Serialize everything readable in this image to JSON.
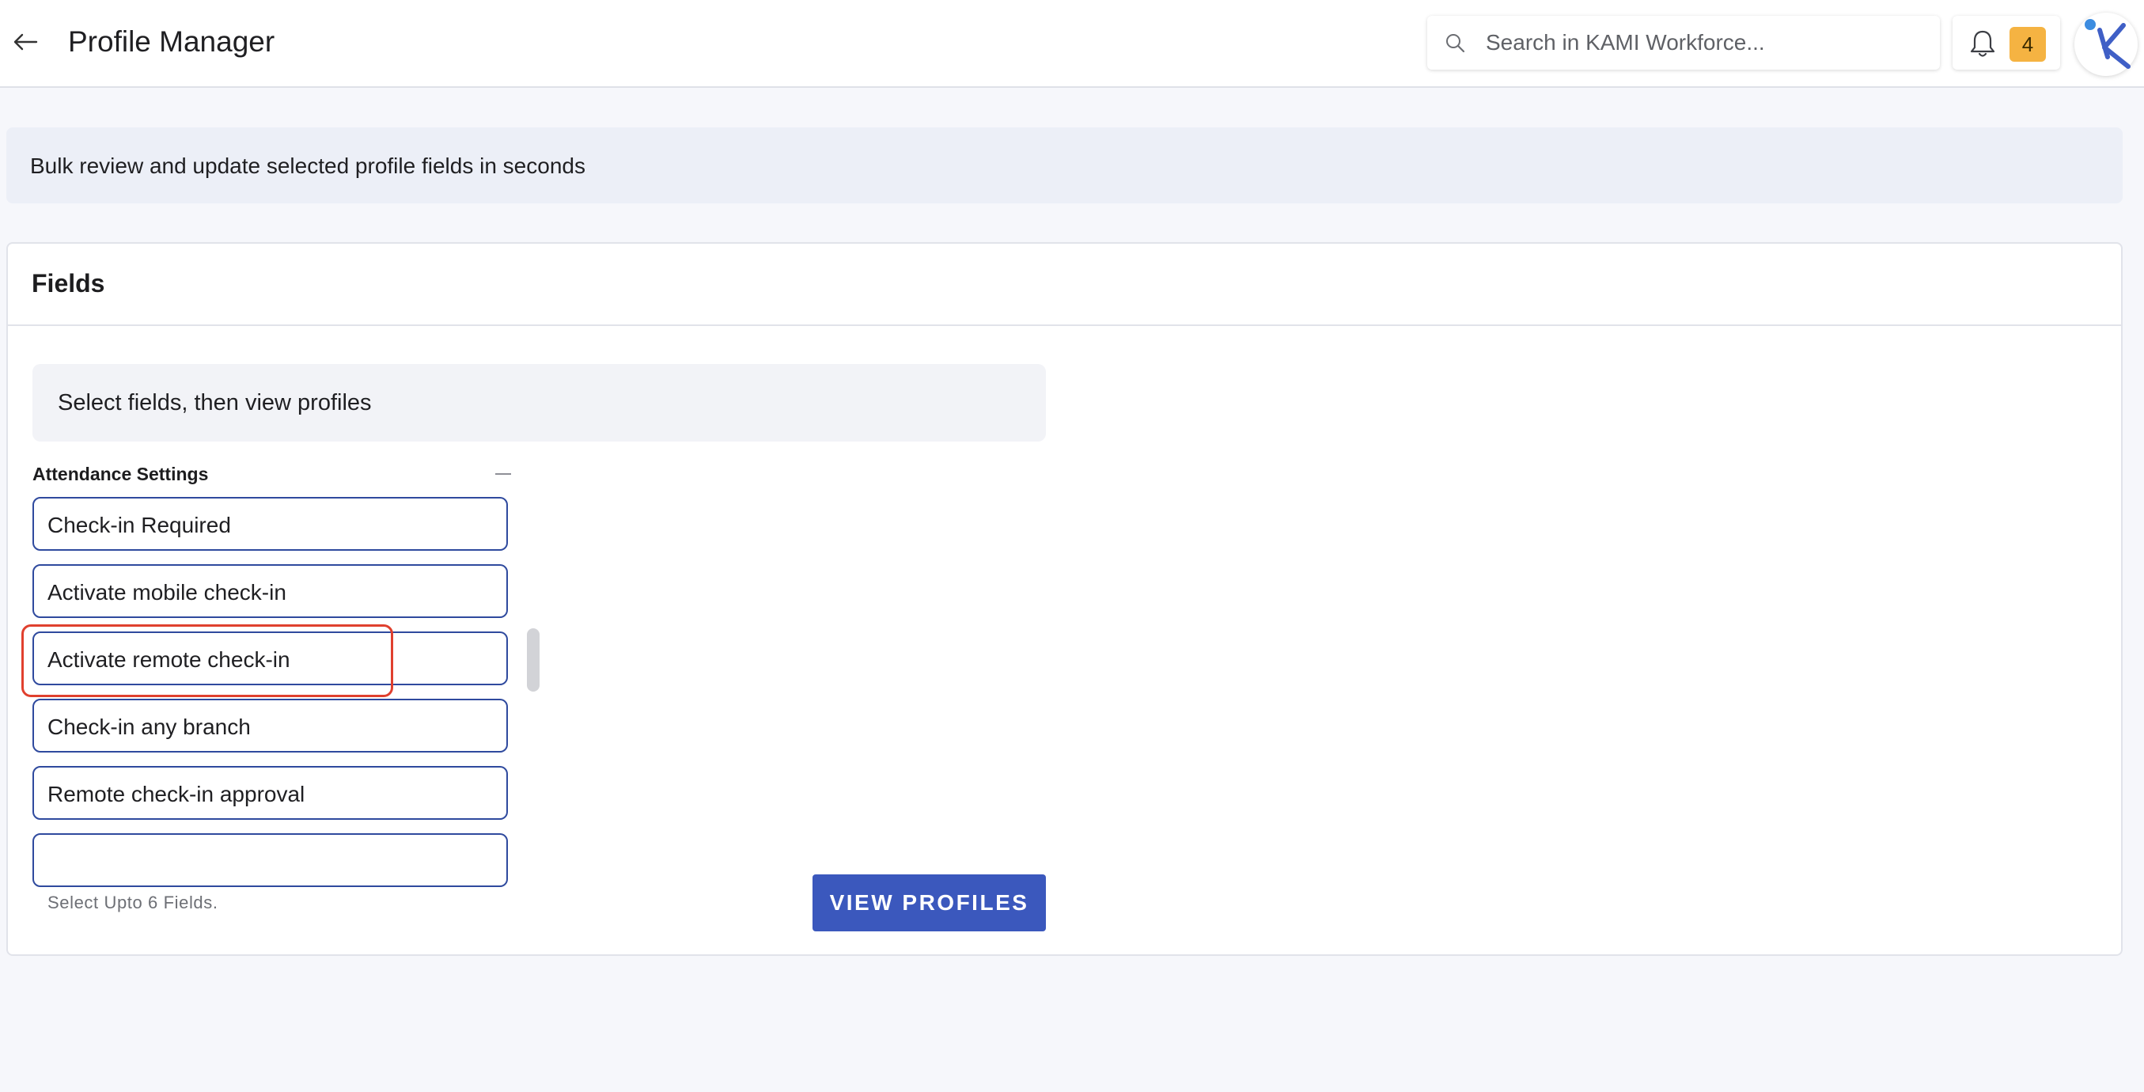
{
  "header": {
    "title": "Profile Manager",
    "search_placeholder": "Search in KAMI Workforce...",
    "notification_count": "4"
  },
  "banner": {
    "text": "Bulk review and update selected profile fields in seconds"
  },
  "fields_card": {
    "title": "Fields",
    "hint": "Select fields, then view profiles",
    "group": {
      "title": "Attendance Settings",
      "items": [
        {
          "label": "Check-in Required"
        },
        {
          "label": "Activate mobile check-in"
        },
        {
          "label": "Activate remote check-in"
        },
        {
          "label": "Check-in any branch"
        },
        {
          "label": "Remote check-in approval"
        },
        {
          "label": ""
        }
      ]
    },
    "footer_note": "Select Upto 6 Fields.",
    "view_button": "VIEW PROFILES"
  },
  "colors": {
    "accent": "#3b58bd",
    "field_border": "#2f4a9e",
    "badge": "#f5b342",
    "highlight": "#e0402e"
  }
}
